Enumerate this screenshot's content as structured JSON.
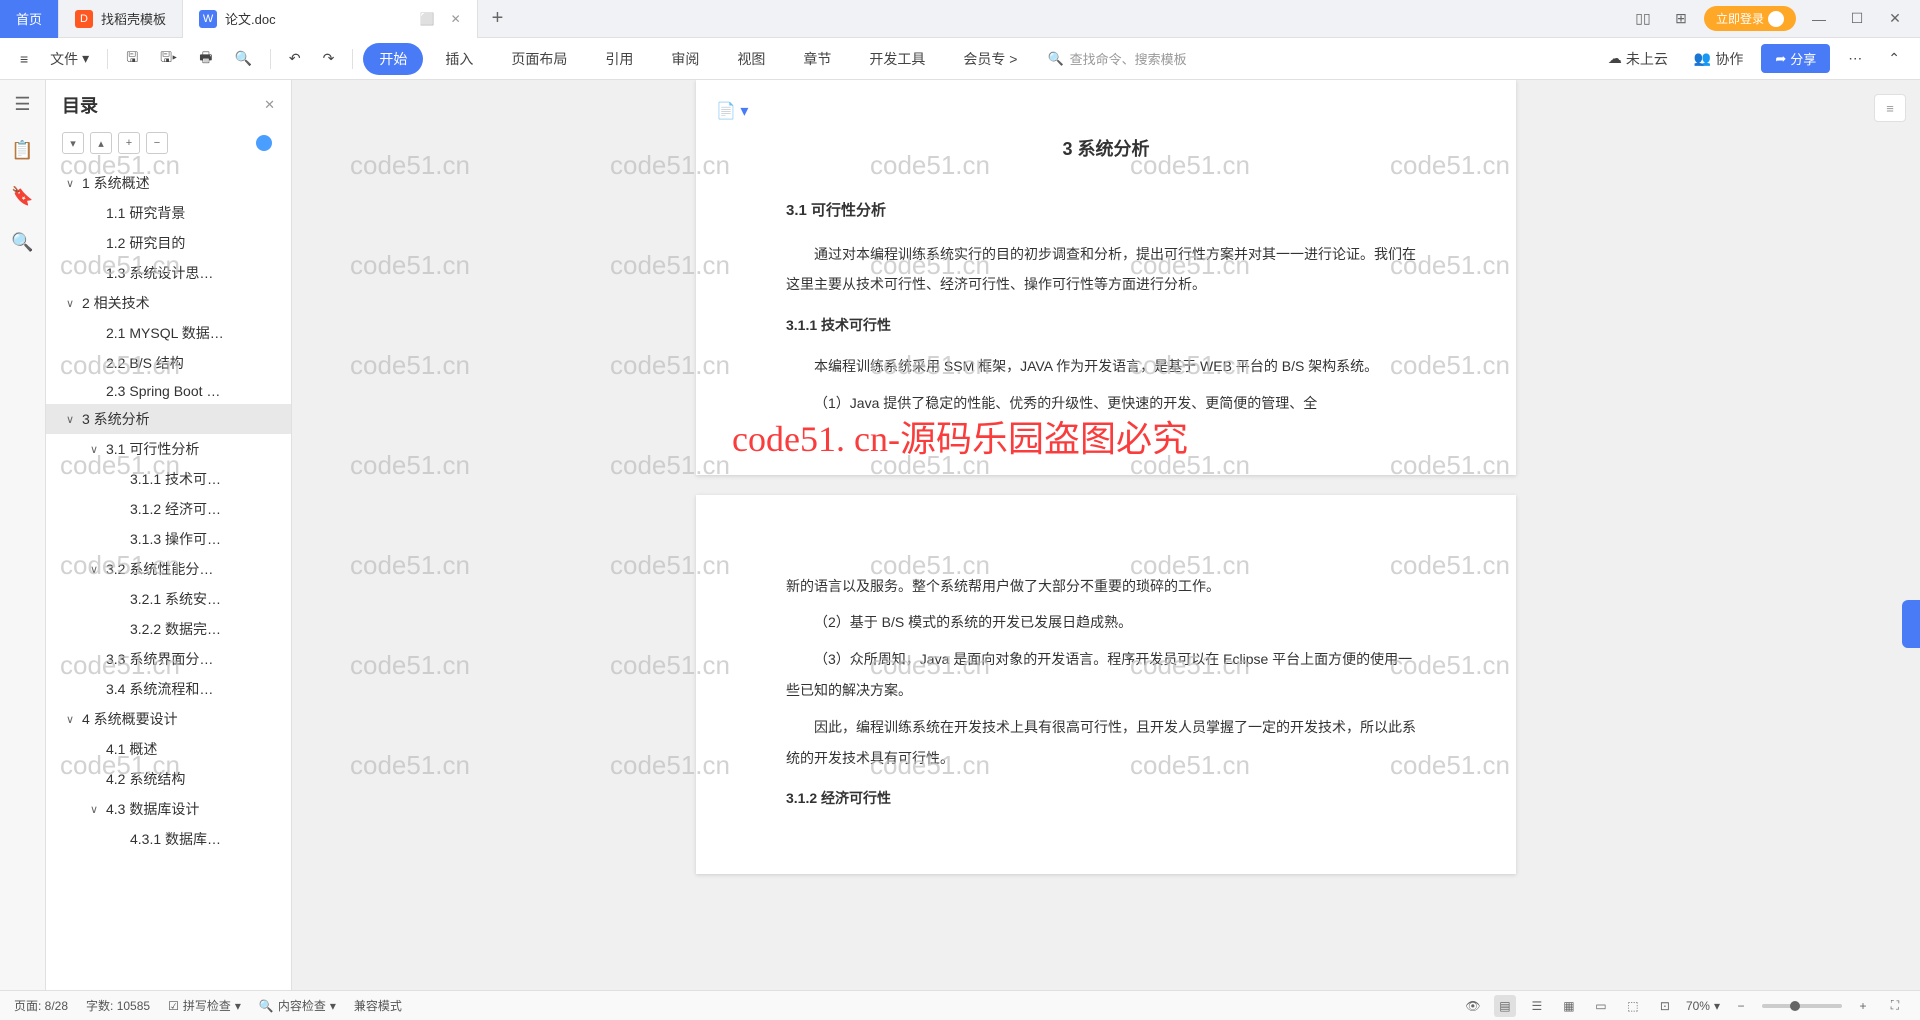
{
  "tabs": {
    "home": "首页",
    "template": "找稻壳模板",
    "doc": "论文.doc"
  },
  "login": "立即登录",
  "toolbar": {
    "file": "文件",
    "menu": {
      "start": "开始",
      "insert": "插入",
      "layout": "页面布局",
      "ref": "引用",
      "review": "审阅",
      "view": "视图",
      "chapter": "章节",
      "devtools": "开发工具",
      "member": "会员专"
    },
    "search_placeholder": "查找命令、搜索模板",
    "not_uploaded": "未上云",
    "collab": "协作",
    "share": "分享"
  },
  "outline": {
    "title": "目录",
    "items": [
      {
        "level": 1,
        "caret": "∨",
        "text": "1 系统概述",
        "active": false
      },
      {
        "level": 2,
        "caret": "",
        "text": "1.1 研究背景",
        "active": false
      },
      {
        "level": 2,
        "caret": "",
        "text": "1.2 研究目的",
        "active": false
      },
      {
        "level": 2,
        "caret": "",
        "text": "1.3 系统设计思…",
        "active": false
      },
      {
        "level": 1,
        "caret": "∨",
        "text": "2 相关技术",
        "active": false
      },
      {
        "level": 2,
        "caret": "",
        "text": "2.1 MYSQL 数据…",
        "active": false
      },
      {
        "level": 2,
        "caret": "",
        "text": "2.2 B/S 结构",
        "active": false
      },
      {
        "level": 2,
        "caret": "",
        "text": "2.3 Spring Boot …",
        "active": false
      },
      {
        "level": 1,
        "caret": "∨",
        "text": "3 系统分析",
        "active": true
      },
      {
        "level": 2,
        "caret": "∨",
        "text": "3.1 可行性分析",
        "active": false
      },
      {
        "level": 3,
        "caret": "",
        "text": "3.1.1 技术可…",
        "active": false
      },
      {
        "level": 3,
        "caret": "",
        "text": "3.1.2 经济可…",
        "active": false
      },
      {
        "level": 3,
        "caret": "",
        "text": "3.1.3 操作可…",
        "active": false
      },
      {
        "level": 2,
        "caret": "∨",
        "text": "3.2 系统性能分…",
        "active": false
      },
      {
        "level": 3,
        "caret": "",
        "text": "3.2.1 系统安…",
        "active": false
      },
      {
        "level": 3,
        "caret": "",
        "text": "3.2.2 数据完…",
        "active": false
      },
      {
        "level": 2,
        "caret": "",
        "text": "3.3 系统界面分…",
        "active": false
      },
      {
        "level": 2,
        "caret": "",
        "text": "3.4 系统流程和…",
        "active": false
      },
      {
        "level": 1,
        "caret": "∨",
        "text": "4 系统概要设计",
        "active": false
      },
      {
        "level": 2,
        "caret": "",
        "text": "4.1 概述",
        "active": false
      },
      {
        "level": 2,
        "caret": "",
        "text": "4.2 系统结构",
        "active": false
      },
      {
        "level": 2,
        "caret": "∨",
        "text": "4.3 数据库设计",
        "active": false
      },
      {
        "level": 3,
        "caret": "",
        "text": "4.3.1 数据库…",
        "active": false
      }
    ]
  },
  "document": {
    "chapter_title": "3 系统分析",
    "s31": "3.1 可行性分析",
    "p1": "通过对本编程训练系统实行的目的初步调查和分析，提出可行性方案并对其一一进行论证。我们在这里主要从技术可行性、经济可行性、操作可行性等方面进行分析。",
    "s311": "3.1.1 技术可行性",
    "p2": "本编程训练系统采用 SSM 框架，JAVA 作为开发语言，是基于 WEB 平台的 B/S 架构系统。",
    "p3": "（1）Java 提供了稳定的性能、优秀的升级性、更快速的开发、更简便的管理、全",
    "p4": "新的语言以及服务。整个系统帮用户做了大部分不重要的琐碎的工作。",
    "p5": "（2）基于 B/S 模式的系统的开发已发展日趋成熟。",
    "p6": "（3）众所周知，Java 是面向对象的开发语言。程序开发员可以在 Eclipse 平台上面方便的使用一些已知的解决方案。",
    "p7": "因此，编程训练系统在开发技术上具有很高可行性，且开发人员掌握了一定的开发技术，所以此系统的开发技术具有可行性。",
    "s312": "3.1.2 经济可行性"
  },
  "watermark": {
    "text": "code51.cn",
    "red": "code51. cn-源码乐园盗图必究"
  },
  "status": {
    "page": "页面: 8/28",
    "words": "字数: 10585",
    "spell": "拼写检查",
    "content_check": "内容检查",
    "compat": "兼容模式",
    "zoom": "70%"
  }
}
